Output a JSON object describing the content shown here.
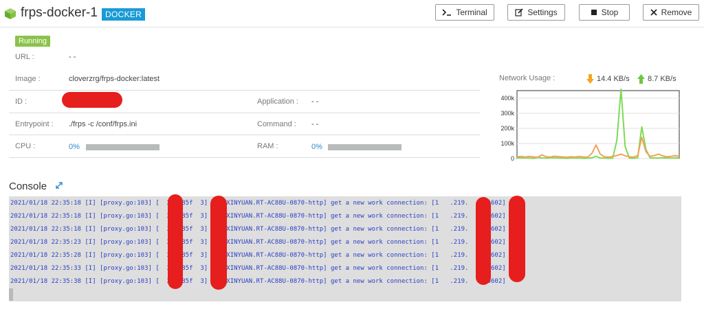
{
  "header": {
    "title": "frps-docker-1",
    "badge": "DOCKER",
    "buttons": {
      "terminal": "Terminal",
      "settings": "Settings",
      "stop": "Stop",
      "remove": "Remove"
    }
  },
  "status": "Running",
  "details": {
    "url_label": "URL :",
    "url_value": "- -",
    "image_label": "Image :",
    "image_value": "cloverzrg/frps-docker:latest",
    "id_label": "ID :",
    "application_label": "Application :",
    "application_value": "- -",
    "entrypoint_label": "Entrypoint :",
    "entrypoint_value": "./frps -c /conf/frps.ini",
    "command_label": "Command :",
    "command_value": "- -",
    "cpu_label": "CPU :",
    "cpu_value": "0%",
    "ram_label": "RAM :",
    "ram_value": "0%"
  },
  "network": {
    "label": "Network Usage :",
    "download": "14.4 KB/s",
    "upload": "8.7 KB/s",
    "colors": {
      "download": "#f5a623",
      "upload": "#6cc644"
    }
  },
  "chart_data": {
    "type": "line",
    "ylim": [
      0,
      450000
    ],
    "y_ticks": [
      "0",
      "100k",
      "200k",
      "300k",
      "400k"
    ],
    "x": [
      0,
      1,
      2,
      3,
      4,
      5,
      6,
      7,
      8,
      9,
      10,
      11,
      12,
      13,
      14,
      15,
      16,
      17,
      18,
      19,
      20,
      21,
      22,
      23,
      24,
      25,
      26,
      27,
      28,
      29,
      30,
      31,
      32,
      33,
      34,
      35,
      36,
      37,
      38,
      39
    ],
    "series": [
      {
        "color": "#7ed957",
        "values": [
          5000,
          4000,
          6000,
          3000,
          2000,
          8000,
          4000,
          3000,
          5000,
          6000,
          4000,
          3000,
          2000,
          5000,
          4000,
          3000,
          2000,
          3000,
          5000,
          15000,
          4000,
          3000,
          2000,
          3000,
          120000,
          460000,
          80000,
          3000,
          2000,
          5000,
          210000,
          60000,
          5000,
          4000,
          3000,
          6000,
          4000,
          3000,
          5000,
          4000
        ]
      },
      {
        "color": "#f5a05a",
        "values": [
          12000,
          15000,
          10000,
          14000,
          11000,
          9000,
          25000,
          12000,
          10000,
          16000,
          13000,
          11000,
          9000,
          12000,
          10000,
          14000,
          11000,
          10000,
          35000,
          90000,
          30000,
          12000,
          10000,
          14000,
          20000,
          30000,
          18000,
          12000,
          10000,
          20000,
          140000,
          45000,
          15000,
          20000,
          30000,
          18000,
          12000,
          15000,
          20000,
          14000
        ]
      }
    ]
  },
  "console": {
    "title": "Console",
    "lines": [
      "2021/01/18 22:35:18 [I] [proxy.go:103] [  255785f  3] [XINXINYUAN.RT-AC88U-0870-http] get a new work connection: [1   .219.   :25602]",
      "2021/01/18 22:35:18 [I] [proxy.go:103] [  255785f  3] [XINXINYUAN.RT-AC88U-0870-http] get a new work connection: [1   .219.   :25602]",
      "2021/01/18 22:35:18 [I] [proxy.go:103] [  255785f  3] [XINXINYUAN.RT-AC88U-0870-http] get a new work connection: [1   .219.   :25602]",
      "2021/01/18 22:35:23 [I] [proxy.go:103] [  255785f  3] [XINXINYUAN.RT-AC88U-0870-http] get a new work connection: [1   .219.   :25602]",
      "2021/01/18 22:35:28 [I] [proxy.go:103] [  255785f  3] [XINXINYUAN.RT-AC88U-0870-http] get a new work connection: [1   .219.   :25602]",
      "2021/01/18 22:35:33 [I] [proxy.go:103] [  255785f  3] [XINXINYUAN.RT-AC88U-0870-http] get a new work connection: [1   .219.   :25602]",
      "2021/01/18 22:35:38 [I] [proxy.go:103] [  255785f  3] [XINXINYUAN.RT-AC88U-0870-http] get a new work connection: [1   .219.   :25602]"
    ]
  }
}
